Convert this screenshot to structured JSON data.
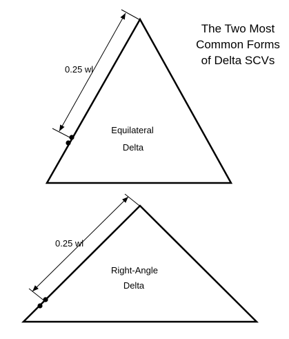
{
  "title": {
    "line1": "The Two Most",
    "line2": "Common Forms",
    "line3": "of Delta SCVs"
  },
  "top_diagram": {
    "name_line1": "Equilateral",
    "name_line2": "Delta",
    "dimension": "0.25 wl"
  },
  "bottom_diagram": {
    "name_line1": "Right-Angle",
    "name_line2": "Delta",
    "dimension": "0.25 wl"
  }
}
